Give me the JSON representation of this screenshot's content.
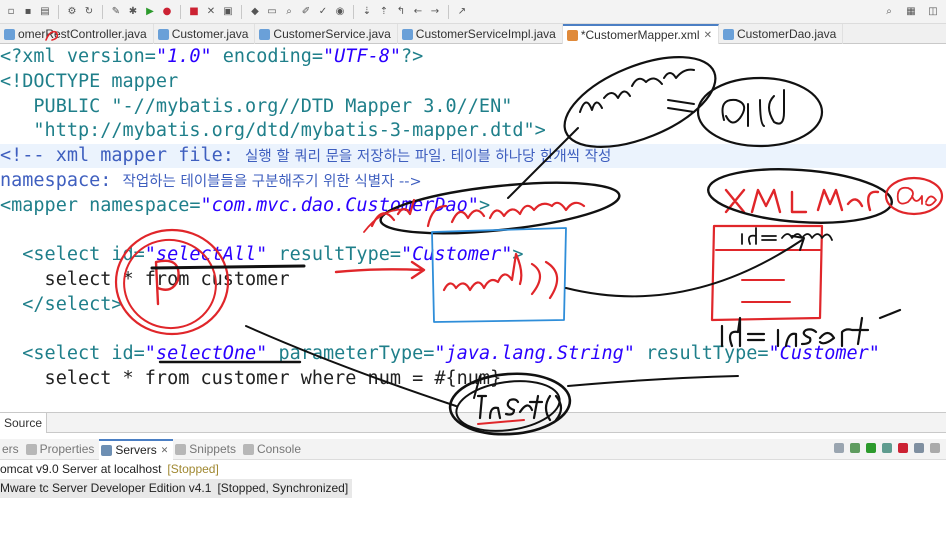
{
  "editor_tabs": [
    {
      "label": "omerRestController.java",
      "active": false
    },
    {
      "label": "Customer.java",
      "active": false
    },
    {
      "label": "CustomerService.java",
      "active": false
    },
    {
      "label": "CustomerServiceImpl.java",
      "active": false
    },
    {
      "label": "*CustomerMapper.xml",
      "active": true
    },
    {
      "label": "CustomerDao.java",
      "active": false
    }
  ],
  "code": {
    "l1": {
      "a": "<?xml version=",
      "b": "\"1.0\"",
      "c": " encoding=",
      "d": "\"UTF-8\"",
      "e": "?>"
    },
    "l2": {
      "a": "<!DOCTYPE mapper"
    },
    "l3": {
      "a": "   PUBLIC \"-//mybatis.org//DTD Mapper 3.0//EN\""
    },
    "l4": {
      "a": "   \"http://mybatis.org/dtd/mybatis-3-mapper.dtd\">"
    },
    "l5": {
      "a": "<!-- xml mapper file: ",
      "b": "실행 할 쿼리 문을 저장하는 파일. 테이블 하나당 한개씩 작성"
    },
    "l6": {
      "a": "namespace: ",
      "b": "작업하는 테이블들을 구분해주기 위한 식별자 -->"
    },
    "l7": {
      "a": "<mapper namespace=",
      "b": "\"com.mvc.dao.CustomerDao\"",
      "c": ">"
    },
    "l9": {
      "a": "  <select id=",
      "b": "\"selectAll\"",
      "c": " resultType=",
      "d": "\"Customer\"",
      "e": ">"
    },
    "l10": {
      "a": "    select * from customer"
    },
    "l11": {
      "a": "  </select>"
    },
    "l13": {
      "a": "  <select id=",
      "b": "\"selectOne\"",
      "c": " parameterType=",
      "d": "\"java.lang.String\"",
      "e": " resultType=",
      "f": "\"Customer\""
    },
    "l14": {
      "a": "    select * from customer where num = #{num}"
    }
  },
  "source_tab": "Source",
  "view_tabs": [
    {
      "label": "ers",
      "active": false
    },
    {
      "label": "Properties",
      "active": false
    },
    {
      "label": "Servers",
      "active": true
    },
    {
      "label": "Snippets",
      "active": false
    },
    {
      "label": "Console",
      "active": false
    }
  ],
  "servers": [
    {
      "name": "omcat v9.0 Server at localhost",
      "status": "[Stopped]"
    },
    {
      "name": "Mware tc Server Developer Edition v4.1",
      "status": "[Stopped, Synchronized]"
    }
  ],
  "colors": {
    "annotation_ink": "#111111",
    "annotation_red": "#e0262a",
    "annotation_blue": "#2f8ed9"
  }
}
